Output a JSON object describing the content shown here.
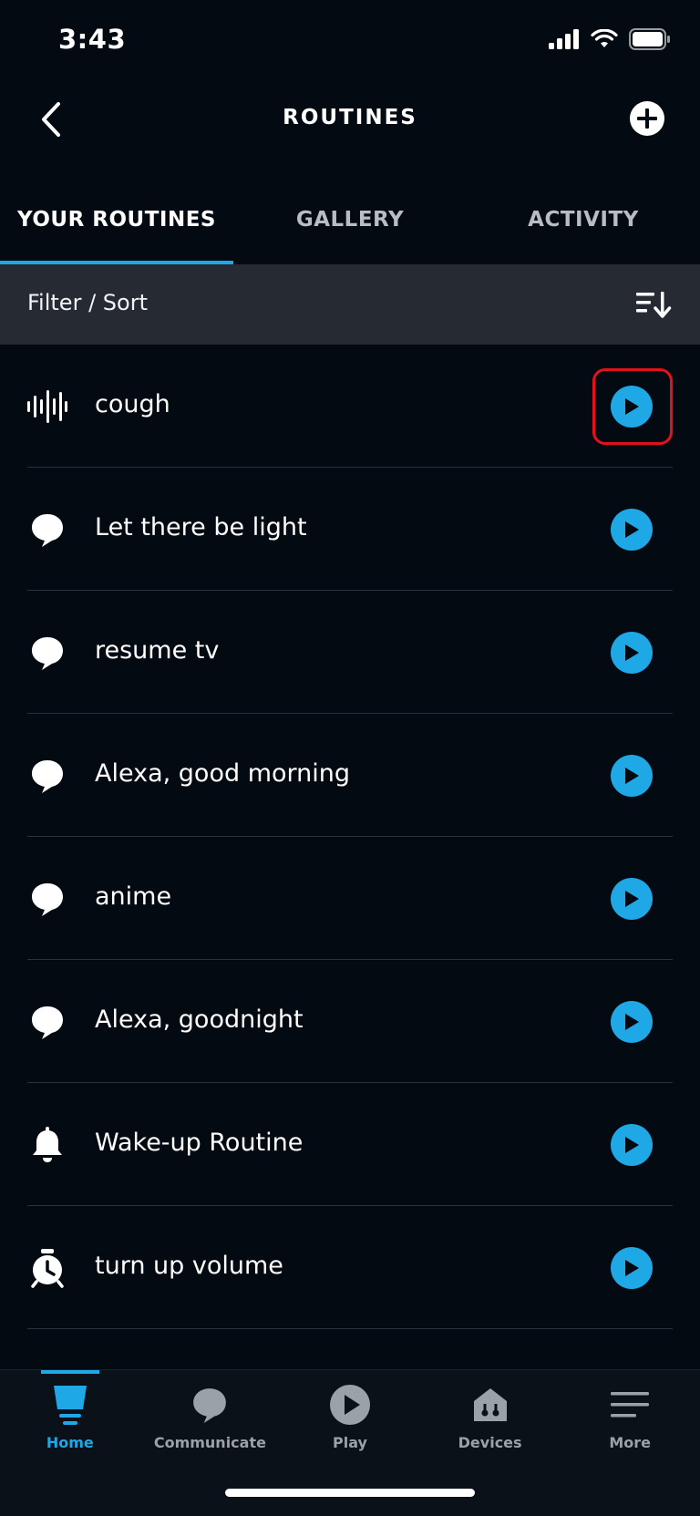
{
  "status": {
    "time": "3:43",
    "signal_icon": "cellular-signal-icon",
    "wifi_icon": "wifi-icon",
    "battery_icon": "battery-icon"
  },
  "header": {
    "title": "ROUTINES",
    "back_icon": "chevron-left-icon",
    "add_icon": "plus-circle-icon"
  },
  "tabs": [
    {
      "label": "YOUR ROUTINES",
      "active": true
    },
    {
      "label": "GALLERY",
      "active": false
    },
    {
      "label": "ACTIVITY",
      "active": false
    }
  ],
  "filter": {
    "label": "Filter / Sort",
    "icon": "sort-icon"
  },
  "routines": [
    {
      "name": "cough",
      "icon": "sound-wave-icon"
    },
    {
      "name": "Let there be light",
      "icon": "speech-bubble-icon"
    },
    {
      "name": "resume tv",
      "icon": "speech-bubble-icon"
    },
    {
      "name": "Alexa, good morning",
      "icon": "speech-bubble-icon"
    },
    {
      "name": "anime",
      "icon": "speech-bubble-icon"
    },
    {
      "name": "Alexa, goodnight",
      "icon": "speech-bubble-icon"
    },
    {
      "name": "Wake-up Routine",
      "icon": "bell-icon"
    },
    {
      "name": "turn up volume",
      "icon": "alarm-clock-icon"
    }
  ],
  "bottom_nav": [
    {
      "label": "Home",
      "icon": "home-icon",
      "active": true
    },
    {
      "label": "Communicate",
      "icon": "chat-bubble-icon",
      "active": false
    },
    {
      "label": "Play",
      "icon": "play-icon",
      "active": false
    },
    {
      "label": "Devices",
      "icon": "devices-icon",
      "active": false
    },
    {
      "label": "More",
      "icon": "menu-icon",
      "active": false
    }
  ],
  "colors": {
    "background": "#040a12",
    "accent": "#1ea8e6",
    "filter_bar": "#262b33",
    "highlight": "#e3111b"
  }
}
